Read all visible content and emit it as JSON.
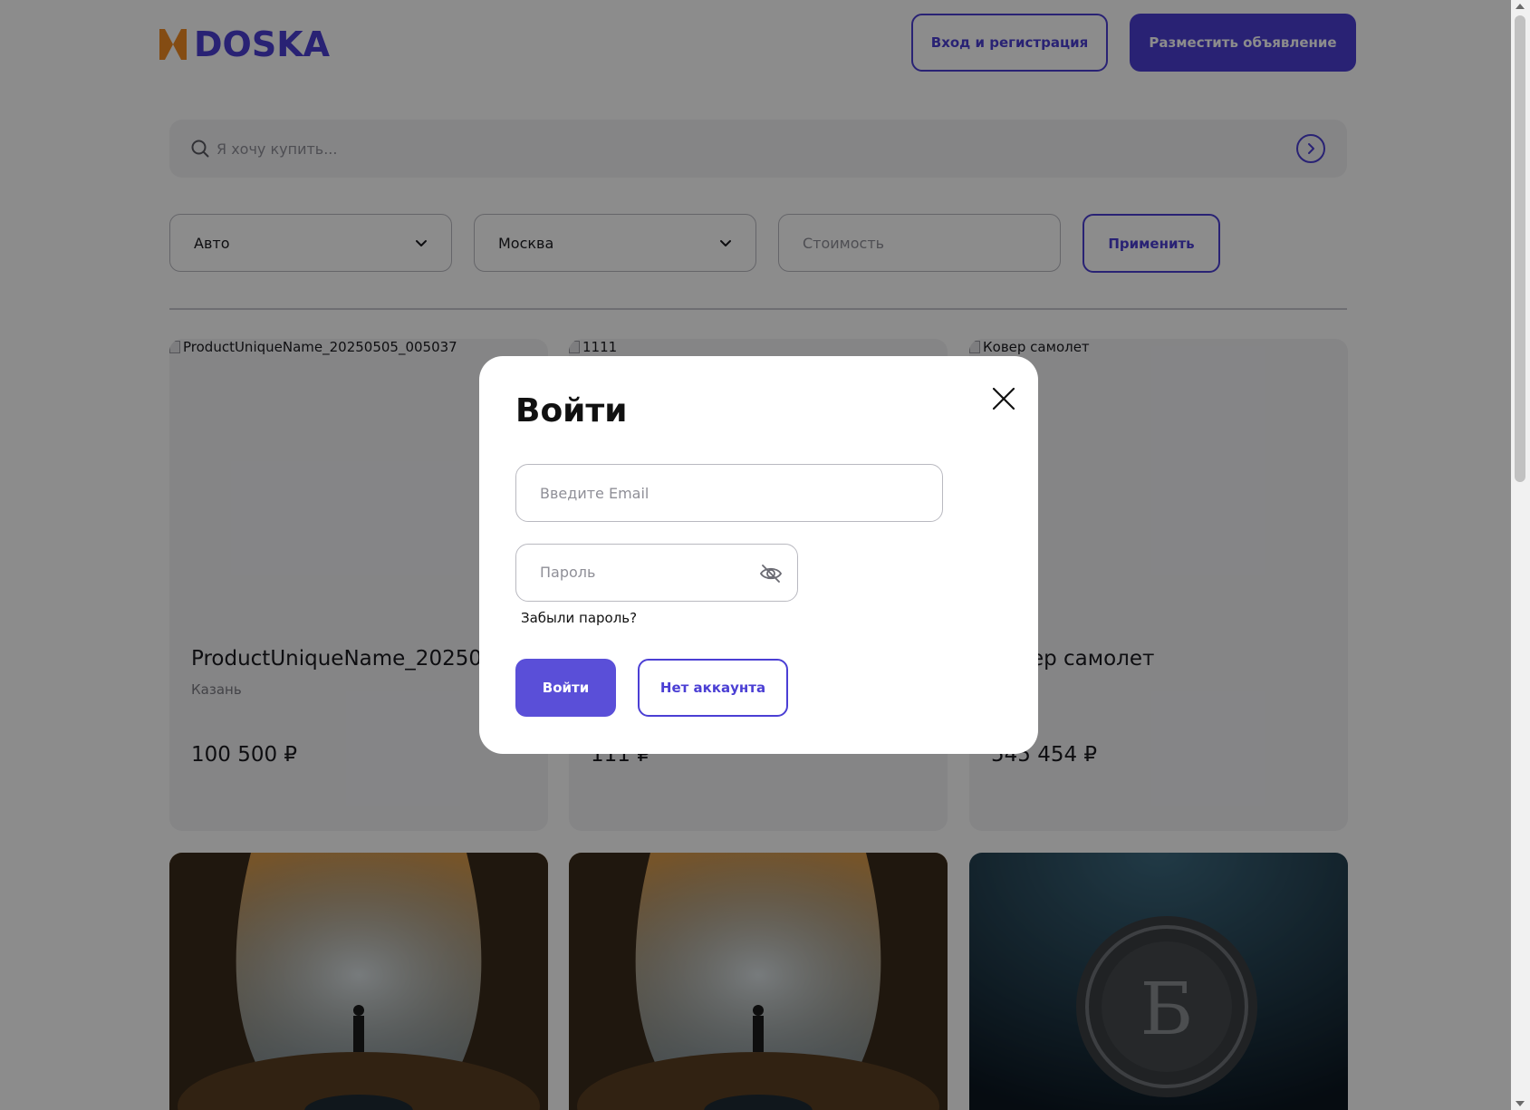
{
  "header": {
    "logo_text": "DOSKA",
    "login_label": "Вход и регистрация",
    "post_label": "Разместить объявление"
  },
  "search": {
    "placeholder": "Я хочу купить..."
  },
  "filters": {
    "category_value": "Авто",
    "city_value": "Москва",
    "price_placeholder": "Стоимость",
    "apply_label": "Применить"
  },
  "listings": [
    {
      "alt": "ProductUniqueName_20250505_005037",
      "title": "ProductUniqueName_20250505_005037",
      "city": "Казань",
      "price": "100 500 ₽"
    },
    {
      "alt": "1111",
      "title": "1111",
      "city": "",
      "price": "111 ₽"
    },
    {
      "alt": "Ковер самолет",
      "title": "Ковер самолет",
      "city": "",
      "price": "545 454 ₽"
    }
  ],
  "modal": {
    "title": "Войти",
    "email_placeholder": "Введите Email",
    "password_placeholder": "Пароль",
    "forgot_label": "Забыли пароль?",
    "submit_label": "Войти",
    "no_account_label": "Нет аккаунта"
  },
  "colors": {
    "brand": "#4b3fd4",
    "accent_logo": "#f08a24",
    "overlay": "rgba(0,0,0,0.45)"
  }
}
